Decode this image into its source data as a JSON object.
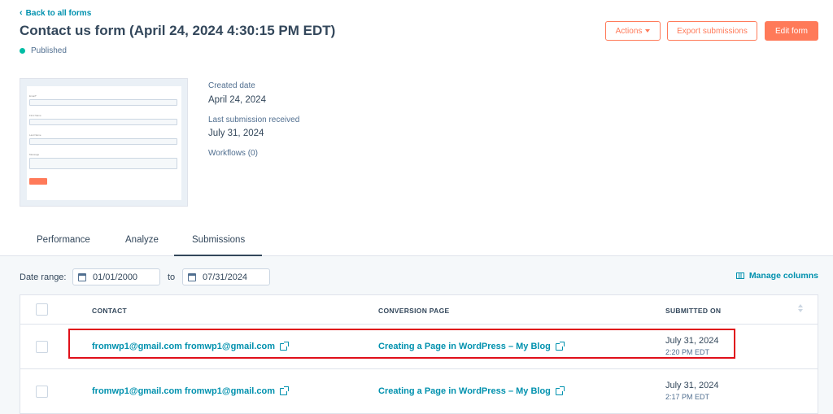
{
  "header": {
    "back_label": "Back to all forms",
    "title": "Contact us form (April 24, 2024 4:30:15 PM EDT)",
    "status": "Published",
    "actions_label": "Actions",
    "export_label": "Export submissions",
    "edit_label": "Edit form"
  },
  "colors": {
    "accent": "#ff7a59",
    "link": "#0091ae",
    "published": "#00bda5",
    "highlight": "#e0101a"
  },
  "details": {
    "created_label": "Created date",
    "created_value": "April 24, 2024",
    "last_sub_label": "Last submission received",
    "last_sub_value": "July 31, 2024",
    "workflows_label": "Workflows (0)"
  },
  "tabs": [
    {
      "label": "Performance"
    },
    {
      "label": "Analyze"
    },
    {
      "label": "Submissions",
      "active": true
    }
  ],
  "filters": {
    "date_range_label": "Date range:",
    "from_date": "01/01/2000",
    "to_label": "to",
    "to_date": "07/31/2024",
    "manage_columns_label": "Manage columns"
  },
  "table": {
    "columns": [
      "CONTACT",
      "CONVERSION PAGE",
      "SUBMITTED ON"
    ],
    "rows": [
      {
        "contact": "fromwp1@gmail.com fromwp1@gmail.com",
        "page": "Creating a Page in WordPress – My Blog",
        "date": "July 31, 2024",
        "time": "2:20 PM EDT"
      },
      {
        "contact": "fromwp1@gmail.com fromwp1@gmail.com",
        "page": "Creating a Page in WordPress – My Blog",
        "date": "July 31, 2024",
        "time": "2:17 PM EDT"
      }
    ]
  }
}
